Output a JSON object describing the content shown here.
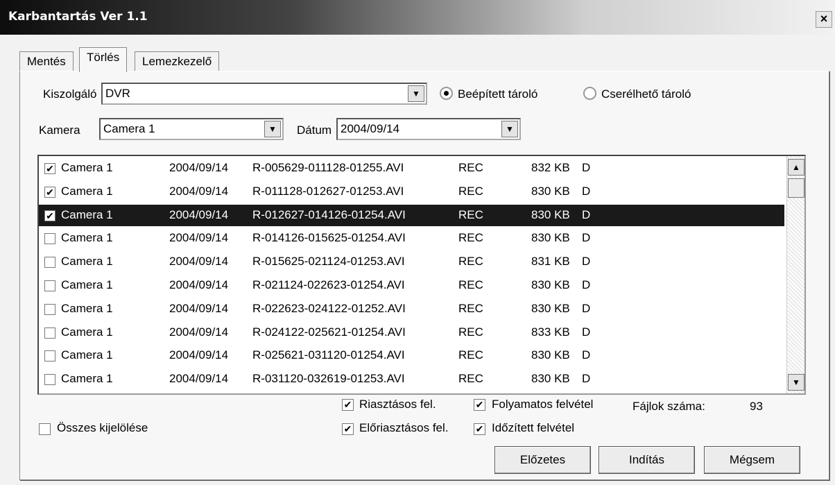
{
  "window": {
    "title": "Karbantartás Ver 1.1",
    "close_label": "×"
  },
  "tabs": [
    {
      "label": "Mentés",
      "active": false
    },
    {
      "label": "Törlés",
      "active": true
    },
    {
      "label": "Lemezkezelő",
      "active": false
    }
  ],
  "server": {
    "label": "Kiszolgáló",
    "value": "DVR"
  },
  "storage": {
    "builtin_label": "Beépített tároló",
    "builtin_selected": true,
    "removable_label": "Cserélhető tároló",
    "removable_selected": false
  },
  "camera": {
    "label": "Kamera",
    "value": "Camera 1"
  },
  "date": {
    "label": "Dátum",
    "value": "2004/09/14"
  },
  "files": [
    {
      "checked": true,
      "camera": "Camera 1",
      "date": "2004/09/14",
      "name": "R-005629-011128-01255.AVI",
      "type": "REC",
      "size": "832 KB",
      "flag": "D",
      "selected": false
    },
    {
      "checked": true,
      "camera": "Camera 1",
      "date": "2004/09/14",
      "name": "R-011128-012627-01253.AVI",
      "type": "REC",
      "size": "830 KB",
      "flag": "D",
      "selected": false
    },
    {
      "checked": true,
      "camera": "Camera 1",
      "date": "2004/09/14",
      "name": "R-012627-014126-01254.AVI",
      "type": "REC",
      "size": "830 KB",
      "flag": "D",
      "selected": true
    },
    {
      "checked": false,
      "camera": "Camera 1",
      "date": "2004/09/14",
      "name": "R-014126-015625-01254.AVI",
      "type": "REC",
      "size": "830 KB",
      "flag": "D",
      "selected": false
    },
    {
      "checked": false,
      "camera": "Camera 1",
      "date": "2004/09/14",
      "name": "R-015625-021124-01253.AVI",
      "type": "REC",
      "size": "831 KB",
      "flag": "D",
      "selected": false
    },
    {
      "checked": false,
      "camera": "Camera 1",
      "date": "2004/09/14",
      "name": "R-021124-022623-01254.AVI",
      "type": "REC",
      "size": "830 KB",
      "flag": "D",
      "selected": false
    },
    {
      "checked": false,
      "camera": "Camera 1",
      "date": "2004/09/14",
      "name": "R-022623-024122-01252.AVI",
      "type": "REC",
      "size": "830 KB",
      "flag": "D",
      "selected": false
    },
    {
      "checked": false,
      "camera": "Camera 1",
      "date": "2004/09/14",
      "name": "R-024122-025621-01254.AVI",
      "type": "REC",
      "size": "833 KB",
      "flag": "D",
      "selected": false
    },
    {
      "checked": false,
      "camera": "Camera 1",
      "date": "2004/09/14",
      "name": "R-025621-031120-01254.AVI",
      "type": "REC",
      "size": "830 KB",
      "flag": "D",
      "selected": false
    },
    {
      "checked": false,
      "camera": "Camera 1",
      "date": "2004/09/14",
      "name": "R-031120-032619-01253.AVI",
      "type": "REC",
      "size": "830 KB",
      "flag": "D",
      "selected": false
    }
  ],
  "filters": {
    "alarm": {
      "label": "Riasztásos fel.",
      "checked": true
    },
    "continuous": {
      "label": "Folyamatos felvétel",
      "checked": true
    },
    "prealarm": {
      "label": "Előriasztásos fel.",
      "checked": true
    },
    "scheduled": {
      "label": "Időzített felvétel",
      "checked": true
    }
  },
  "file_count": {
    "label": "Fájlok száma:",
    "value": "93"
  },
  "select_all": {
    "label": "Összes kijelölése",
    "checked": false
  },
  "buttons": {
    "previous": "Előzetes",
    "start": "Indítás",
    "cancel": "Mégsem"
  },
  "icons": {
    "check": "✔",
    "arrow_down": "▼",
    "arrow_up": "▲"
  }
}
